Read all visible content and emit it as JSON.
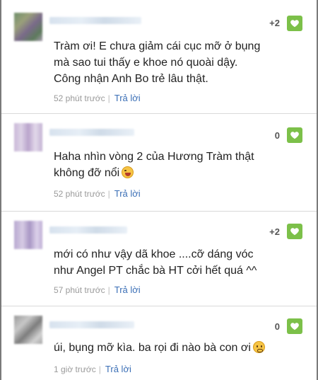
{
  "comments": [
    {
      "likes": "+2",
      "text_lines": [
        "Tràm ơi! E chưa giảm cái cục mỡ ở bụng",
        "mà sao tui thấy e khoe nó quoài dậy.",
        "Công nhận Anh Bo trẻ lâu thật."
      ],
      "time": "52 phút trước",
      "reply_label": "Trả lời"
    },
    {
      "likes": "0",
      "text_lines": [
        "Haha nhìn vòng 2 của Hương Tràm thật",
        "không đỡ nổi"
      ],
      "emoji": "laughing-face-icon",
      "time": "52 phút trước",
      "reply_label": "Trả lời"
    },
    {
      "likes": "+2",
      "text_lines": [
        "mới có như vậy dã khoe ....cỡ dáng vóc",
        "như Angel PT chắc bà HT cởi hết quá ^^"
      ],
      "time": "57 phút trước",
      "reply_label": "Trả lời"
    },
    {
      "likes": "0",
      "text_lines": [
        "úi, bụng mỡ kìa. ba rọi đi nào bà con ơi"
      ],
      "emoji": "worried-face-icon",
      "time": "1 giờ trước",
      "reply_label": "Trả lời"
    }
  ],
  "colors": {
    "like_button": "#7cc049",
    "reply_link": "#3b6fb6",
    "timestamp": "#9a9a9a"
  }
}
